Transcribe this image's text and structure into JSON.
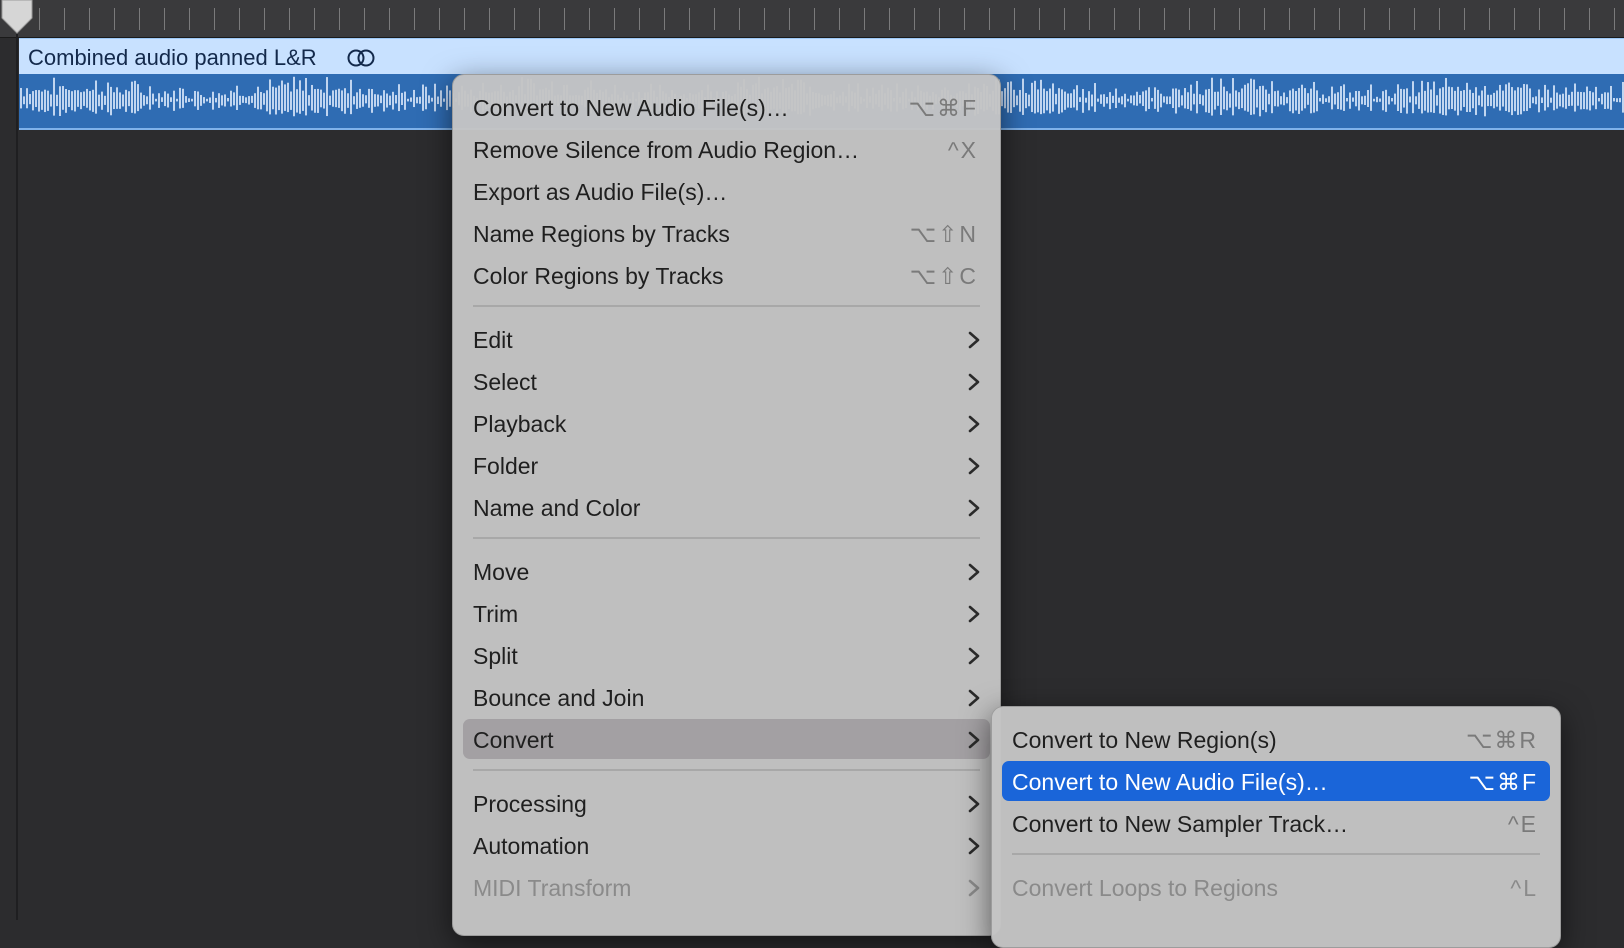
{
  "region": {
    "title": "Combined audio panned L&R",
    "icon": "loop-link-icon",
    "color": "#2f6cb3"
  },
  "main_menu": {
    "items": [
      {
        "label": "Convert to New Audio File(s)…",
        "shortcut": "⌥⌘F"
      },
      {
        "label": "Remove Silence from Audio Region…",
        "shortcut": "^X"
      },
      {
        "label": "Export as Audio File(s)…",
        "shortcut": ""
      },
      {
        "label": "Name Regions by Tracks",
        "shortcut": "⌥⇧N"
      },
      {
        "label": "Color Regions by Tracks",
        "shortcut": "⌥⇧C"
      },
      {
        "label": "Edit"
      },
      {
        "label": "Select"
      },
      {
        "label": "Playback"
      },
      {
        "label": "Folder"
      },
      {
        "label": "Name and Color"
      },
      {
        "label": "Move"
      },
      {
        "label": "Trim"
      },
      {
        "label": "Split"
      },
      {
        "label": "Bounce and Join"
      },
      {
        "label": "Convert"
      },
      {
        "label": "Processing"
      },
      {
        "label": "Automation"
      },
      {
        "label": "MIDI Transform"
      }
    ]
  },
  "sub_menu": {
    "items": [
      {
        "label": "Convert to New Region(s)",
        "shortcut": "⌥⌘R"
      },
      {
        "label": "Convert to New Audio File(s)…",
        "shortcut": "⌥⌘F"
      },
      {
        "label": "Convert to New Sampler Track…",
        "shortcut": "^E"
      },
      {
        "label": "Convert Loops to Regions",
        "shortcut": "^L"
      }
    ]
  },
  "colors": {
    "selection": "#1a65d9",
    "region_header": "#c8e1ff",
    "menu_background": "#c4c4c4"
  }
}
